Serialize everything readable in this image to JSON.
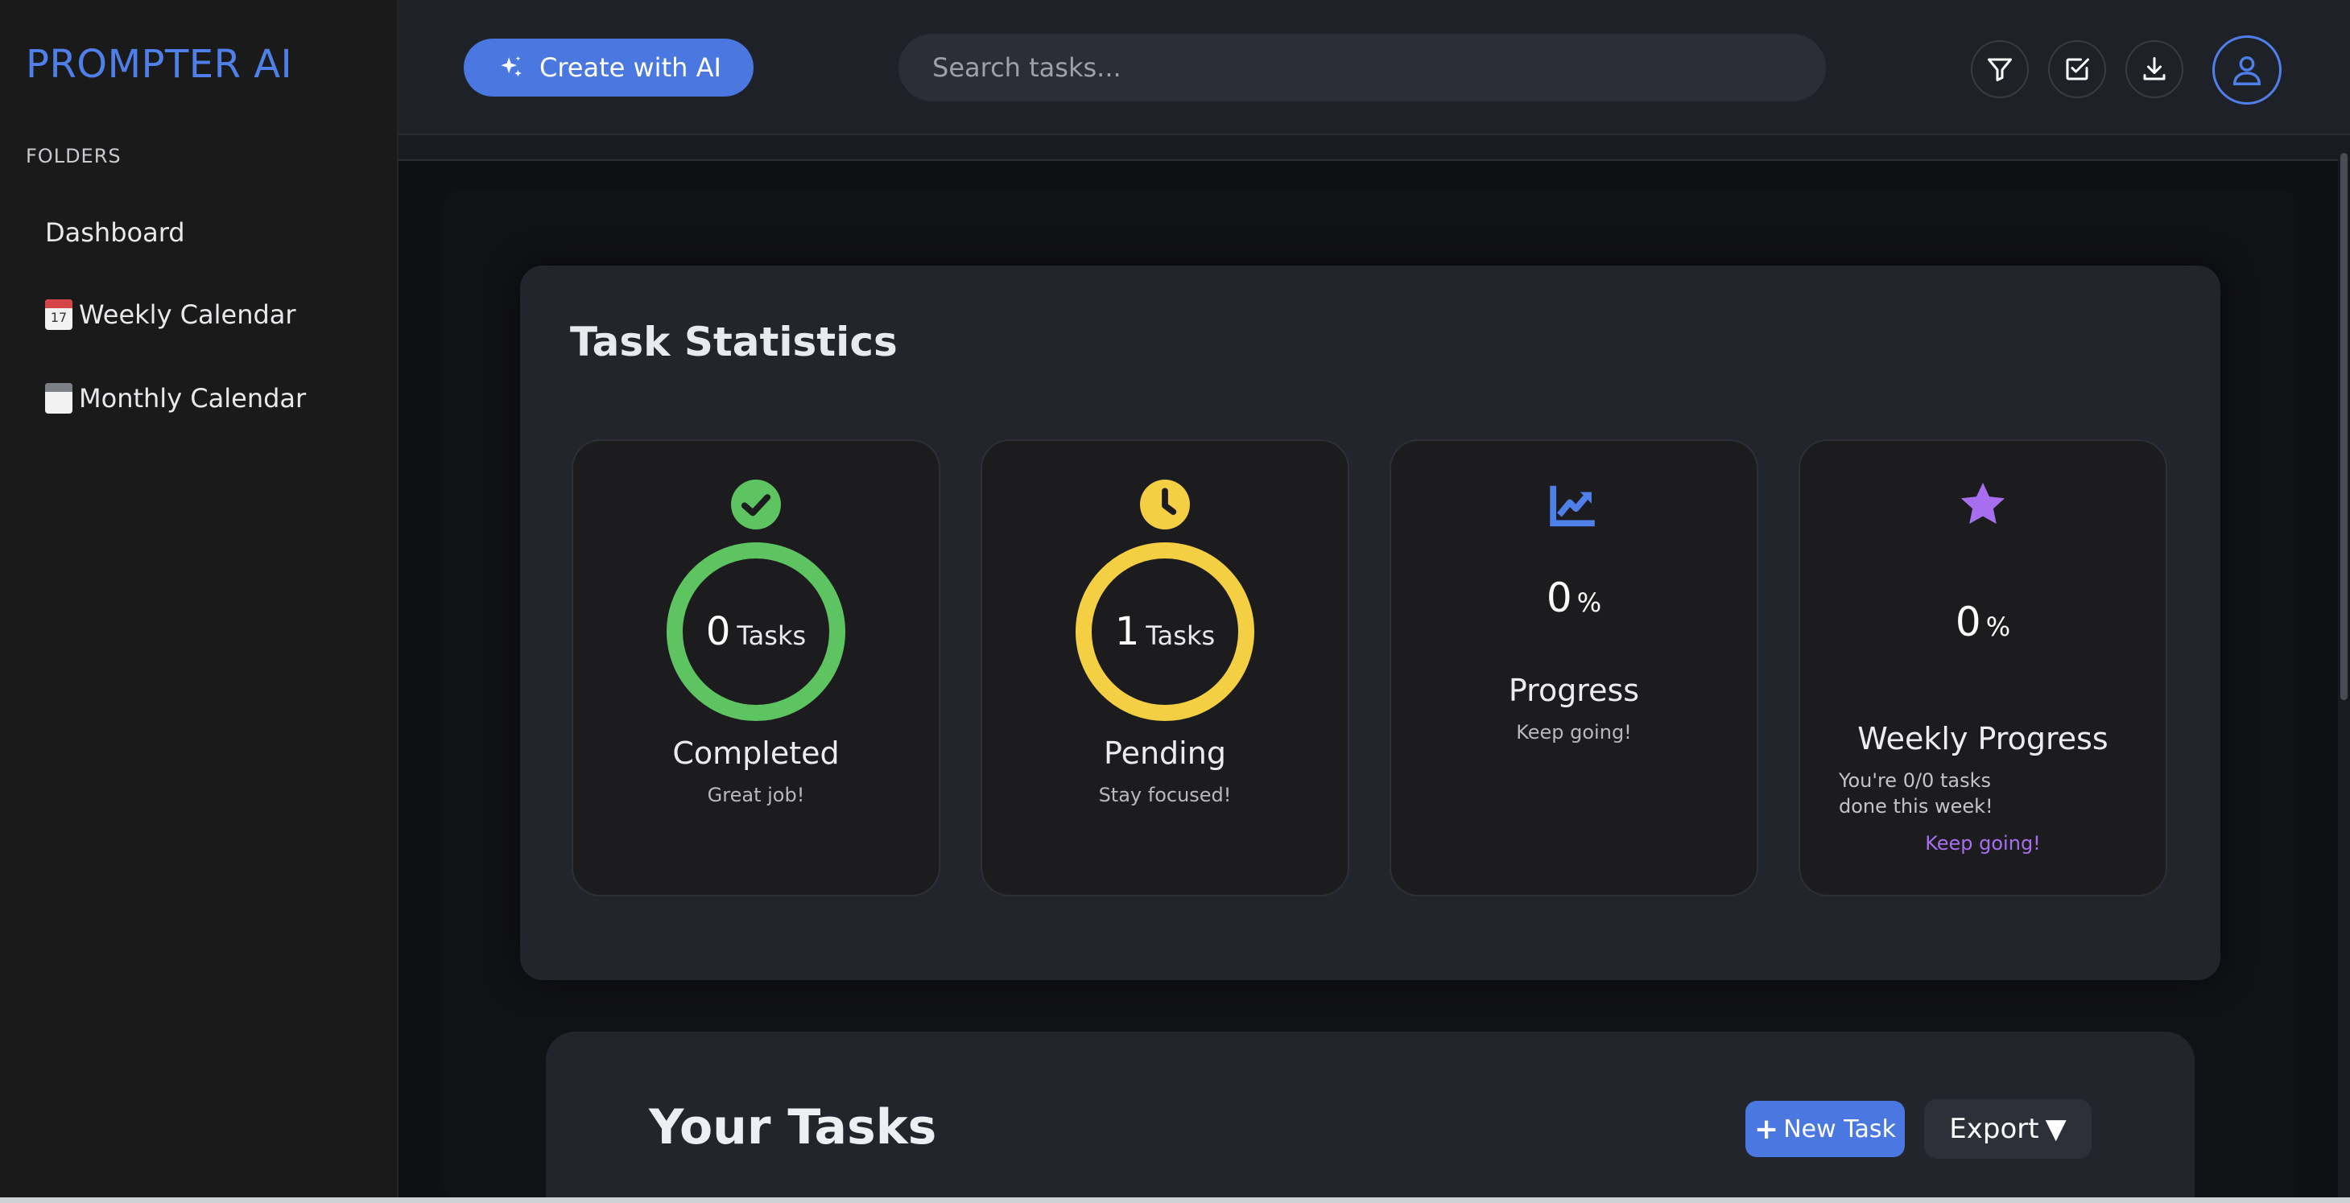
{
  "app": {
    "brand": "PROMPTER AI"
  },
  "sidebar": {
    "section_label": "FOLDERS",
    "items": [
      {
        "label": "Dashboard",
        "icon": ""
      },
      {
        "label": "Weekly Calendar",
        "icon": "calendar-17-icon"
      },
      {
        "label": "Monthly Calendar",
        "icon": "spiral-calendar-icon"
      }
    ],
    "weekly_icon_day": "17"
  },
  "header": {
    "create_label": "Create with AI",
    "search_placeholder": "Search tasks...",
    "icons": [
      "filter-icon",
      "checkbox-icon",
      "download-icon",
      "user-icon"
    ]
  },
  "stats": {
    "title": "Task Statistics",
    "completed": {
      "count": "0",
      "unit": "Tasks",
      "title": "Completed",
      "subtitle": "Great job!",
      "color": "#5ec462"
    },
    "pending": {
      "count": "1",
      "unit": "Tasks",
      "title": "Pending",
      "subtitle": "Stay focused!",
      "color": "#f4cf43"
    },
    "progress": {
      "value": "0",
      "unit": "%",
      "title": "Progress",
      "subtitle": "Keep going!",
      "color": "#4f80e9"
    },
    "weekly": {
      "value": "0",
      "unit": "%",
      "title": "Weekly Progress",
      "note": "You're 0/0 tasks done this week!",
      "cta": "Keep going!",
      "color": "#a76ff0"
    }
  },
  "tasks": {
    "title": "Your Tasks",
    "new_task_label": "New Task",
    "new_task_prefix": "+",
    "export_label": "Export",
    "export_caret": "▼"
  },
  "colors": {
    "accent": "#4a78e0",
    "background": "#0f1013",
    "card": "#23252d"
  }
}
